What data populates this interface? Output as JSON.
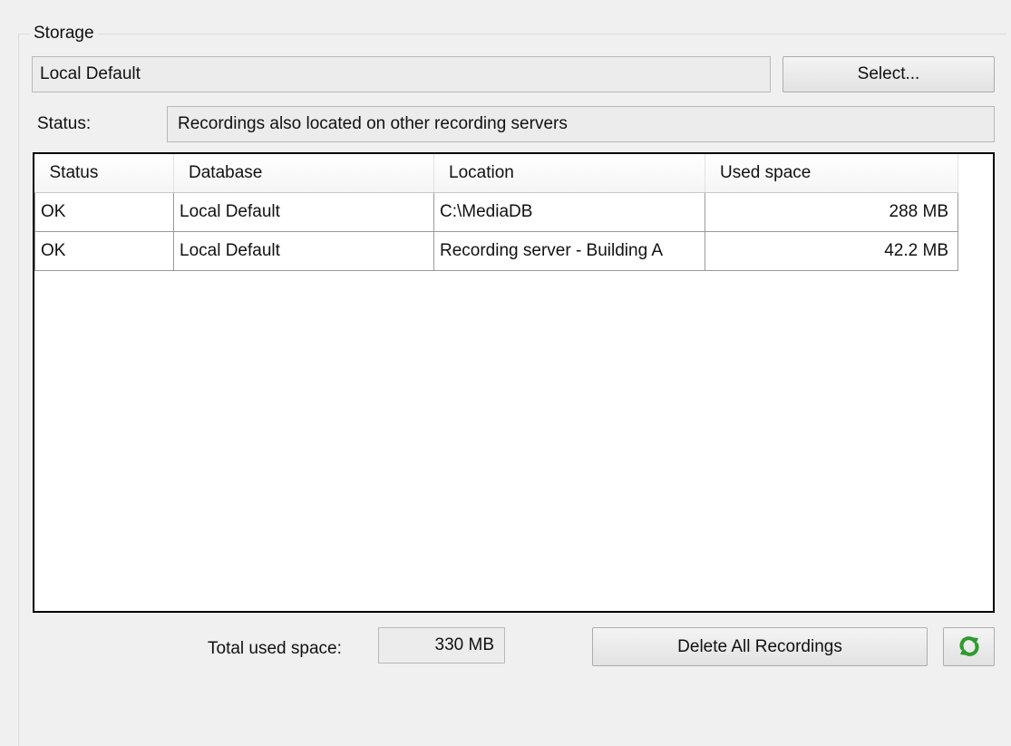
{
  "storage": {
    "group_title": "Storage",
    "selected_storage": "Local Default",
    "select_button_label": "Select...",
    "status_label": "Status:",
    "status_value": "Recordings also located on other recording servers"
  },
  "table": {
    "columns": [
      "Status",
      "Database",
      "Location",
      "Used space"
    ],
    "rows": [
      {
        "status": "OK",
        "database": "Local Default",
        "location": "C:\\MediaDB",
        "used_space": "288 MB"
      },
      {
        "status": "OK",
        "database": "Local Default",
        "location": "Recording server - Building A",
        "used_space": "42.2 MB"
      }
    ]
  },
  "footer": {
    "total_label": "Total used space:",
    "total_value": "330 MB",
    "delete_button_label": "Delete All Recordings",
    "refresh_icon": "refresh-icon"
  },
  "colors": {
    "refresh_icon": "#2e9b2e"
  }
}
